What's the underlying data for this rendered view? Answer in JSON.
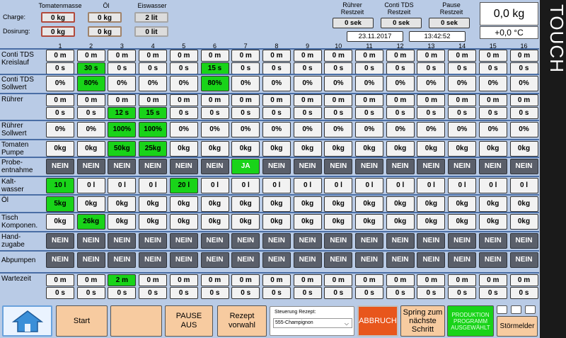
{
  "header": {
    "tomatenmasse_label": "Tomatenmasse",
    "oel_label": "Öl",
    "eiswasser_label": "Eiswasser",
    "charge_label": "Charge:",
    "dosierung_label": "Dosirung:",
    "charge_tomaten": "0 kg",
    "charge_oel": "0 kg",
    "charge_eis": "2 lit",
    "dos_tomaten": "0 kg",
    "dos_oel": "0 kg",
    "dos_eis": "0 lit",
    "ruehrer_rest_label": "Rührer\nRestzeit",
    "conti_rest_label": "Conti TDS\nRestzeit",
    "pause_rest_label": "Pause\nRestzeit",
    "ruehrer_rest": "0 sek",
    "conti_rest": "0 sek",
    "pause_rest": "0 sek",
    "date": "23.11.2017",
    "time": "13:42:52",
    "scale": "0,0 kg",
    "temp": "+0,0 °C"
  },
  "brand": "TOUCH",
  "columns": [
    "1",
    "2",
    "3",
    "4",
    "5",
    "6",
    "7",
    "8",
    "9",
    "10",
    "11",
    "12",
    "13",
    "14",
    "15",
    "16"
  ],
  "rows": [
    {
      "label": "Conti TDS\nKreislauf",
      "type": "double",
      "top": [
        "0 m",
        "0 m",
        "0 m",
        "0 m",
        "0 m",
        "0 m",
        "0 m",
        "0 m",
        "0 m",
        "0 m",
        "0 m",
        "0 m",
        "0 m",
        "0 m",
        "0 m",
        "0 m"
      ],
      "bottom": [
        "0 s",
        "30 s",
        "0 s",
        "0 s",
        "0 s",
        "15 s",
        "0 s",
        "0 s",
        "0 s",
        "0 s",
        "0 s",
        "0 s",
        "0 s",
        "0 s",
        "0 s",
        "0 s"
      ],
      "bottom_on": [
        2,
        6
      ]
    },
    {
      "label": "Conti TDS\nSollwert",
      "type": "single",
      "values": [
        "0%",
        "80%",
        "0%",
        "0%",
        "0%",
        "80%",
        "0%",
        "0%",
        "0%",
        "0%",
        "0%",
        "0%",
        "0%",
        "0%",
        "0%",
        "0%"
      ],
      "on": [
        2,
        6
      ]
    },
    {
      "label": "Rührer",
      "type": "double",
      "top": [
        "0 m",
        "0 m",
        "0 m",
        "0 m",
        "0 m",
        "0 m",
        "0 m",
        "0 m",
        "0 m",
        "0 m",
        "0 m",
        "0 m",
        "0 m",
        "0 m",
        "0 m",
        "0 m"
      ],
      "bottom": [
        "0 s",
        "0 s",
        "12 s",
        "15 s",
        "0 s",
        "0 s",
        "0 s",
        "0 s",
        "0 s",
        "0 s",
        "0 s",
        "0 s",
        "0 s",
        "0 s",
        "0 s",
        "0 s"
      ],
      "bottom_on": [
        3,
        4
      ]
    },
    {
      "label": "Rührer\nSollwert",
      "type": "single",
      "values": [
        "0%",
        "0%",
        "100%",
        "100%",
        "0%",
        "0%",
        "0%",
        "0%",
        "0%",
        "0%",
        "0%",
        "0%",
        "0%",
        "0%",
        "0%",
        "0%"
      ],
      "on": [
        3,
        4
      ]
    },
    {
      "label": "Tomaten\nPumpe",
      "type": "single",
      "values": [
        "0kg",
        "0kg",
        "50kg",
        "25kg",
        "0kg",
        "0kg",
        "0kg",
        "0kg",
        "0kg",
        "0kg",
        "0kg",
        "0kg",
        "0kg",
        "0kg",
        "0kg",
        "0kg"
      ],
      "on": [
        3,
        4
      ]
    },
    {
      "label": "Probe-\nentnahme",
      "type": "flag",
      "values": [
        "NEIN",
        "NEIN",
        "NEIN",
        "NEIN",
        "NEIN",
        "NEIN",
        "JA",
        "NEIN",
        "NEIN",
        "NEIN",
        "NEIN",
        "NEIN",
        "NEIN",
        "NEIN",
        "NEIN",
        "NEIN"
      ],
      "on": [
        7
      ]
    },
    {
      "label": "Kalt-\nwasser",
      "type": "single",
      "values": [
        "10 l",
        "0 l",
        "0 l",
        "0 l",
        "20 l",
        "0 l",
        "0 l",
        "0 l",
        "0 l",
        "0 l",
        "0 l",
        "0 l",
        "0 l",
        "0 l",
        "0 l",
        "0 l"
      ],
      "on": [
        1,
        5
      ]
    },
    {
      "label": "Öl",
      "type": "single",
      "values": [
        "5kg",
        "0kg",
        "0kg",
        "0kg",
        "0kg",
        "0kg",
        "0kg",
        "0kg",
        "0kg",
        "0kg",
        "0kg",
        "0kg",
        "0kg",
        "0kg",
        "0kg",
        "0kg"
      ],
      "on": [
        1
      ]
    },
    {
      "label": "Tisch\nKomponen.",
      "type": "single",
      "values": [
        "0kg",
        "26kg",
        "0kg",
        "0kg",
        "0kg",
        "0kg",
        "0kg",
        "0kg",
        "0kg",
        "0kg",
        "0kg",
        "0kg",
        "0kg",
        "0kg",
        "0kg",
        "0kg"
      ],
      "on": [
        2
      ]
    },
    {
      "label": "Hand-\nzugabe",
      "type": "flag",
      "values": [
        "NEIN",
        "NEIN",
        "NEIN",
        "NEIN",
        "NEIN",
        "NEIN",
        "NEIN",
        "NEIN",
        "NEIN",
        "NEIN",
        "NEIN",
        "NEIN",
        "NEIN",
        "NEIN",
        "NEIN",
        "NEIN"
      ],
      "on": []
    },
    {
      "label": "Abpumpen",
      "type": "flag",
      "values": [
        "NEIN",
        "NEIN",
        "NEIN",
        "NEIN",
        "NEIN",
        "NEIN",
        "NEIN",
        "NEIN",
        "NEIN",
        "NEIN",
        "NEIN",
        "NEIN",
        "NEIN",
        "NEIN",
        "NEIN",
        "NEIN"
      ],
      "on": []
    },
    {
      "label": "Wartezeit",
      "type": "double",
      "top": [
        "0 m",
        "0 m",
        "2 m",
        "0 m",
        "0 m",
        "0 m",
        "0 m",
        "0 m",
        "0 m",
        "0 m",
        "0 m",
        "0 m",
        "0 m",
        "0 m",
        "0 m",
        "0 m"
      ],
      "bottom": [
        "0 s",
        "0 s",
        "0 s",
        "0 s",
        "0 s",
        "0 s",
        "0 s",
        "0 s",
        "0 s",
        "0 s",
        "0 s",
        "0 s",
        "0 s",
        "0 s",
        "0 s",
        "0 s"
      ],
      "top_on": [
        3
      ]
    }
  ],
  "bottom": {
    "start": "Start",
    "blank": "",
    "pause": "PAUSE\nAUS",
    "rezept": "Rezept\nvorwahl",
    "steuerung_label": "Steuerung Rezept:",
    "steuerung_value": "555-Champignon",
    "abbruch": "ABBRUCH",
    "spring": "Spring zum\nnächste\nSchritt",
    "produktion": "PRODUKTION\nPROGRAMM\nAUSGEWÄHLT",
    "stoermelder": "Störmelder"
  }
}
